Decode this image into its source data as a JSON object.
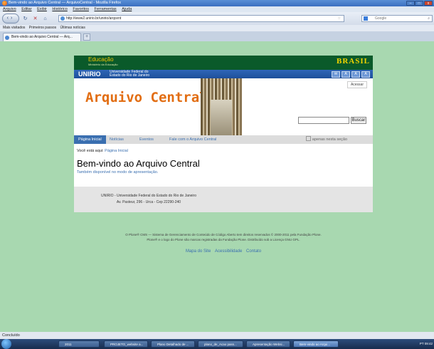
{
  "window": {
    "title": "Bem-vindo ao Arquivo Central — ArquivoCentral - Mozilla Firefox"
  },
  "menu": [
    "Arquivo",
    "Editar",
    "Exibir",
    "Histórico",
    "Favoritos",
    "Ferramentas",
    "Ajuda"
  ],
  "nav": {
    "url": "http://www2.unirio.br/unirio/arqcent",
    "search_placeholder": "Google"
  },
  "bookmarks": [
    "Mais visitados",
    "Primeiros passos",
    "Últimas notícias"
  ],
  "tab": {
    "label": "Bem-vindo ao Arquivo Central — Arq...",
    "new_tab": "+"
  },
  "gov": {
    "education": "Educação",
    "education_sub": "Ministério da Educação",
    "brasil": "BRASIL"
  },
  "uni": {
    "logo": "UNIRIO",
    "full_line1": "Universidade Federal do",
    "full_line2": "Estado do Rio de Janeiro",
    "a11y": [
      "A",
      "A",
      "A"
    ]
  },
  "header": {
    "title": "Arquivo Central",
    "login": "Acessar",
    "search_button": "Buscar"
  },
  "navtabs": [
    "Página Inicial",
    "Notícias",
    "Eventos",
    "Fale com o Arquivo Central"
  ],
  "search_scope": "apenas nesta seção",
  "content": {
    "crumb_prefix": "Você está aqui:",
    "crumb_link": "Página Inicial",
    "heading": "Bem-vindo ao Arquivo Central",
    "alt_link": "Também disponível no modo de apresentação."
  },
  "footer": {
    "line1": "UNIRIO - Universidade Federal do Estado do Rio de Janeiro",
    "line2": "Av. Pasteur, 296 - Urca - Cep 22290-240"
  },
  "credits": {
    "line1": "O Plone® CMS — Sistema de Gerenciamento de Conteúdo de Código Aberto tem direitos reservados © 2000-2011 pela Fundação Plone.",
    "line2": "Plone® e o logo do Plone são marcas registradas da Fundação Plone. Distribuído sob a Licença GNU GPL."
  },
  "links": [
    "Mapa do Site",
    "Acessibilidade",
    "Contato"
  ],
  "status": "Concluído",
  "taskbar": {
    "items": [
      "2011",
      "PROJETO_website a...",
      "Plano Detalhado de ...",
      "plano_de_Acao pass...",
      "Apresentação Websi...",
      "Bem-vindo ao Arqui..."
    ],
    "tray": "PT  09:42"
  }
}
